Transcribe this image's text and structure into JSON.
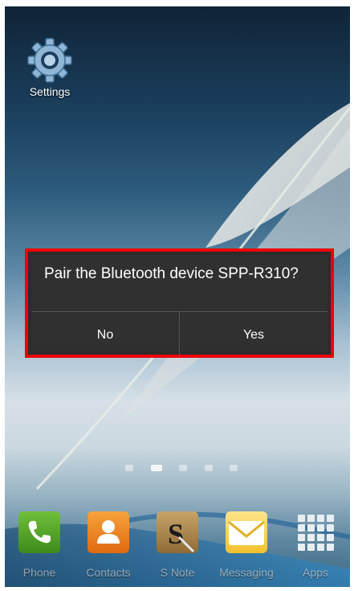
{
  "home_screen": {
    "shortcuts": [
      {
        "label": "Settings",
        "icon": "gear-icon"
      }
    ],
    "page_indicator": {
      "pages": 5,
      "current": 2
    }
  },
  "dialog": {
    "message": "Pair the Bluetooth device SPP-R310?",
    "buttons": {
      "no": "No",
      "yes": "Yes"
    },
    "highlight_color": "#ee0000"
  },
  "dock": {
    "items": [
      {
        "label": "Phone",
        "icon": "phone-icon",
        "color": "#4a9a24"
      },
      {
        "label": "Contacts",
        "icon": "contacts-icon",
        "color": "#ea7d1e"
      },
      {
        "label": "S Note",
        "icon": "s-note-icon",
        "color": "#a8844c"
      },
      {
        "label": "Messaging",
        "icon": "envelope-icon",
        "color": "#f3c12e"
      },
      {
        "label": "Apps",
        "icon": "apps-grid-icon",
        "color": "#ffffff"
      }
    ]
  }
}
